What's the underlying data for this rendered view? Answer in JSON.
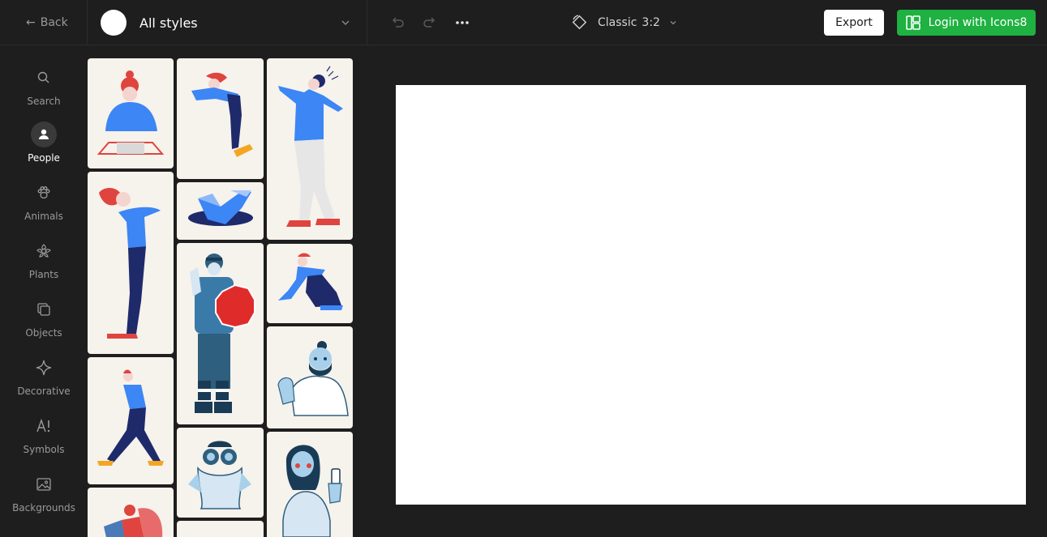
{
  "header": {
    "back_label": "Back",
    "style_selector": "All styles",
    "format_label": "Classic",
    "format_ratio": "3:2",
    "export_label": "Export",
    "login_label": "Login with Icons8"
  },
  "sidebar": {
    "items": [
      {
        "label": "Search",
        "icon": "search-icon"
      },
      {
        "label": "People",
        "icon": "person-icon",
        "active": true
      },
      {
        "label": "Animals",
        "icon": "paw-icon"
      },
      {
        "label": "Plants",
        "icon": "flower-icon"
      },
      {
        "label": "Objects",
        "icon": "objects-icon"
      },
      {
        "label": "Decorative",
        "icon": "sparkle-icon"
      },
      {
        "label": "Symbols",
        "icon": "symbols-icon"
      },
      {
        "label": "Backgrounds",
        "icon": "image-icon"
      }
    ]
  },
  "colors": {
    "accent_green": "#1fb141",
    "card_bg": "#f6f2ec",
    "dark_bg": "#1e1e1e"
  }
}
